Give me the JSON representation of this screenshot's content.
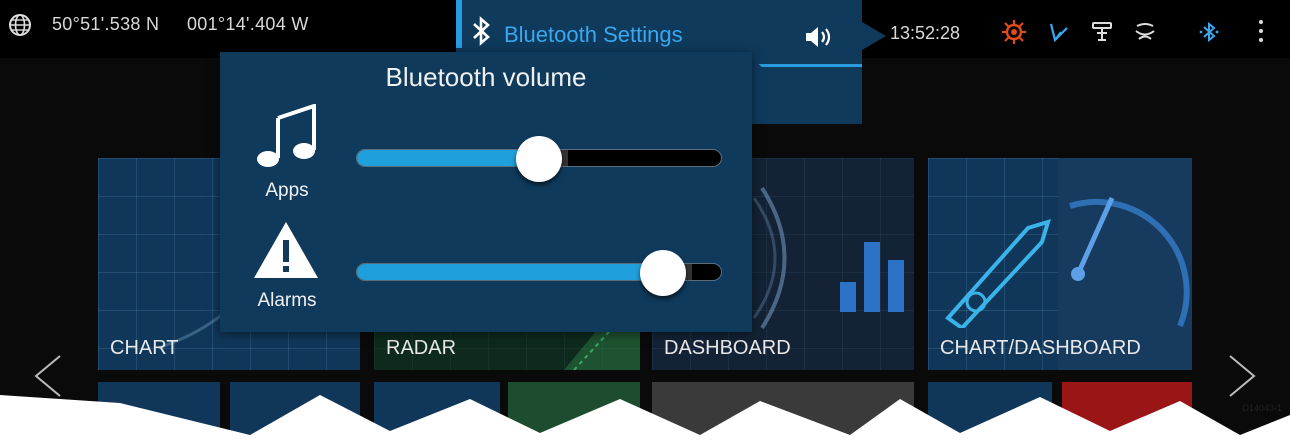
{
  "status_bar": {
    "latitude": "50°51'.538 N",
    "longitude": "001°14'.404 W",
    "time": "13:52:28",
    "icons": [
      "globe-icon",
      "helm-alarm-icon",
      "ais-icon",
      "autopilot-icon",
      "sonar-icon",
      "bluetooth-icon",
      "menu-icon"
    ]
  },
  "bluetooth_settings": {
    "title": "Bluetooth Settings",
    "partial_value": "0"
  },
  "volume_popup": {
    "title": "Bluetooth volume",
    "apps": {
      "label": "Apps",
      "level": 0.5
    },
    "alarms": {
      "label": "Alarms",
      "level": 0.84
    }
  },
  "tiles": [
    {
      "label": "CHART"
    },
    {
      "label": "RADAR"
    },
    {
      "label": "DASHBOARD"
    },
    {
      "label": "CHART/DASHBOARD"
    }
  ],
  "figure_code": "D14043-1",
  "colors": {
    "accent": "#2a9be0",
    "panel": "#0f3a5c",
    "slider_fill": "#1fa0dc"
  }
}
